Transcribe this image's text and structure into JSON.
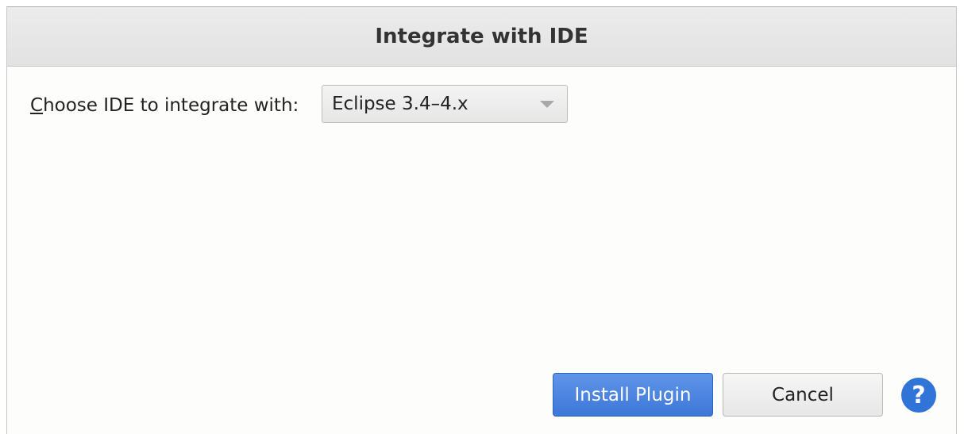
{
  "dialog": {
    "title": "Integrate with IDE"
  },
  "ide_choice": {
    "label_mnemonic": "C",
    "label_rest": "hoose IDE to integrate with:",
    "selected_value": "Eclipse 3.4–4.x"
  },
  "buttons": {
    "install_label": "Install Plugin",
    "cancel_label": "Cancel",
    "help_glyph": "?"
  },
  "colors": {
    "accent": "#3d77d8",
    "help_icon": "#2f74d6"
  },
  "icons": {
    "dropdown": "chevron-down-icon",
    "help": "help-icon"
  }
}
